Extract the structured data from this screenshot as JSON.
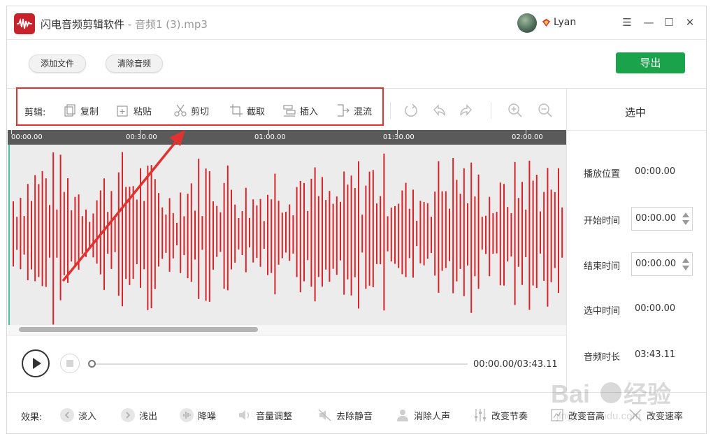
{
  "app": {
    "title": "闪电音频剪辑软件",
    "file": " - 音频1 (3).mp3"
  },
  "user": {
    "name": "Lyan"
  },
  "window_controls": {
    "menu": "☰",
    "minimize": "—",
    "maximize": "☐",
    "close": "✕"
  },
  "top_buttons": {
    "add_file": "添加文件",
    "clear_audio": "清除音频",
    "export": "导出"
  },
  "edit_toolbar": {
    "label": "剪辑:",
    "tools": [
      {
        "name": "copy",
        "label": "复制"
      },
      {
        "name": "paste",
        "label": "粘贴"
      },
      {
        "name": "cut",
        "label": "剪切"
      },
      {
        "name": "crop",
        "label": "截取"
      },
      {
        "name": "insert",
        "label": "插入"
      },
      {
        "name": "mix",
        "label": "混流"
      }
    ]
  },
  "timeline": {
    "ticks": [
      "00:00.00",
      "00:30.00",
      "01:00.00",
      "01:30.00",
      "02:00.00"
    ]
  },
  "player": {
    "time": "00:00.00/03:43.11"
  },
  "panel": {
    "title": "选中",
    "play_position_label": "播放位置",
    "play_position": "00:00.00",
    "start_time_label": "开始时间",
    "start_time": "00:00.00",
    "end_time_label": "结束时间",
    "end_time": "00:00.00",
    "selected_time_label": "选中时间",
    "selected_time": "00:00.00",
    "duration_label": "音频时长",
    "duration": "03:43.11"
  },
  "effects": {
    "label": "效果:",
    "items": [
      {
        "name": "fade-in",
        "label": "淡入"
      },
      {
        "name": "fade-out",
        "label": "浅出"
      },
      {
        "name": "noise-reduction",
        "label": "降噪"
      },
      {
        "name": "volume",
        "label": "音量调整"
      },
      {
        "name": "remove-silence",
        "label": "去除静音"
      },
      {
        "name": "remove-vocals",
        "label": "消除人声"
      },
      {
        "name": "tempo",
        "label": "改变节奏"
      },
      {
        "name": "pitch",
        "label": "改变音高"
      },
      {
        "name": "speed",
        "label": "改变速率"
      }
    ]
  },
  "colors": {
    "waveform": "#d6252a",
    "export": "#1aa34a",
    "annotation": "#e0322f",
    "playhead": "#4fc1a6"
  },
  "watermark": {
    "brand": "Baidu经验",
    "url": "jingyan.baidu.com"
  }
}
